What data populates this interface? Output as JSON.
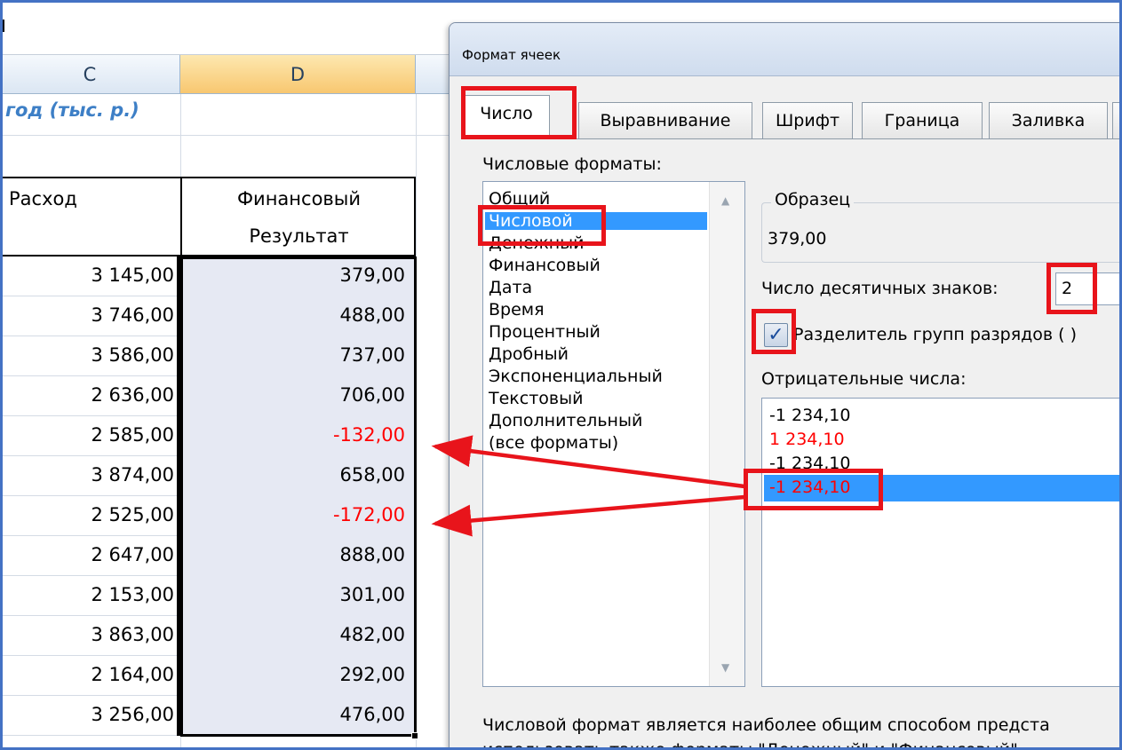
{
  "sheet": {
    "columns": [
      "C",
      "D"
    ],
    "title_fragment": "год (тыс. р.)",
    "header_expense": "Расход",
    "header_result_line1": "Финансовый",
    "header_result_line2": "Результат",
    "rows": [
      {
        "expense": "3 145,00",
        "result": "379,00",
        "negative": false
      },
      {
        "expense": "3 746,00",
        "result": "488,00",
        "negative": false
      },
      {
        "expense": "3 586,00",
        "result": "737,00",
        "negative": false
      },
      {
        "expense": "2 636,00",
        "result": "706,00",
        "negative": false
      },
      {
        "expense": "2 585,00",
        "result": "-132,00",
        "negative": true
      },
      {
        "expense": "3 874,00",
        "result": "658,00",
        "negative": false
      },
      {
        "expense": "2 525,00",
        "result": "-172,00",
        "negative": true
      },
      {
        "expense": "2 647,00",
        "result": "888,00",
        "negative": false
      },
      {
        "expense": "2 153,00",
        "result": "301,00",
        "negative": false
      },
      {
        "expense": "3 863,00",
        "result": "482,00",
        "negative": false
      },
      {
        "expense": "2 164,00",
        "result": "292,00",
        "negative": false
      },
      {
        "expense": "3 256,00",
        "result": "476,00",
        "negative": false
      }
    ]
  },
  "dialog": {
    "title": "Формат ячеек",
    "tabs": [
      "Число",
      "Выравнивание",
      "Шрифт",
      "Граница",
      "Заливка"
    ],
    "active_tab": "Число",
    "formats_label": "Числовые форматы:",
    "formats": [
      "Общий",
      "Числовой",
      "Денежный",
      "Финансовый",
      "Дата",
      "Время",
      "Процентный",
      "Дробный",
      "Экспоненциальный",
      "Текстовый",
      "Дополнительный",
      "(все форматы)"
    ],
    "selected_format": "Числовой",
    "sample_label": "Образец",
    "sample_value": "379,00",
    "decimals_label": "Число десятичных знаков:",
    "decimals_value": "2",
    "separator_label": "Разделитель групп разрядов ( )",
    "separator_checked": true,
    "negative_label": "Отрицательные числа:",
    "negative_options": [
      {
        "text": "-1 234,10",
        "red": false
      },
      {
        "text": "1 234,10",
        "red": true
      },
      {
        "text": "-1 234,10",
        "red": false
      },
      {
        "text": "-1 234,10",
        "red": true
      }
    ],
    "description_line1": "Числовой формат является наиболее общим способом предста",
    "description_line2": "использовать также форматы \"Денежный\" и \"Финансовый\"",
    "highlight_color": "#e8141b",
    "selection_color": "#3399ff"
  }
}
